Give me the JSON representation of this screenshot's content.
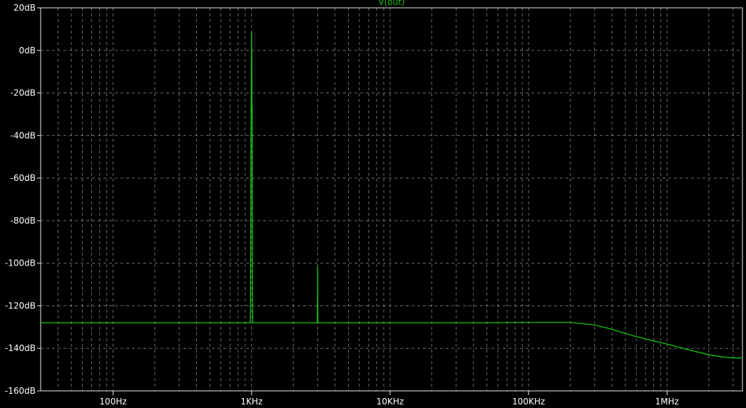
{
  "chart_data": {
    "type": "line",
    "title": "",
    "legend": "V(out)",
    "xscale": "log",
    "xlim": [
      30,
      3500000
    ],
    "ylim": [
      -160,
      20
    ],
    "x_ticks": [
      {
        "value": 100,
        "label": "100Hz"
      },
      {
        "value": 1000,
        "label": "1KHz"
      },
      {
        "value": 10000,
        "label": "10KHz"
      },
      {
        "value": 100000,
        "label": "100KHz"
      },
      {
        "value": 1000000,
        "label": "1MHz"
      }
    ],
    "y_ticks": [
      {
        "value": 20,
        "label": "20dB"
      },
      {
        "value": 0,
        "label": "0dB"
      },
      {
        "value": -20,
        "label": "-20dB"
      },
      {
        "value": -40,
        "label": "-40dB"
      },
      {
        "value": -60,
        "label": "-60dB"
      },
      {
        "value": -80,
        "label": "-80dB"
      },
      {
        "value": -100,
        "label": "-100dB"
      },
      {
        "value": -120,
        "label": "-120dB"
      },
      {
        "value": -140,
        "label": "-140dB"
      },
      {
        "value": -160,
        "label": "-160dB"
      }
    ],
    "series": [
      {
        "name": "V(out)",
        "color": "#16c50f",
        "points": [
          [
            30,
            -128
          ],
          [
            100,
            -128
          ],
          [
            980,
            -128
          ],
          [
            985,
            -94
          ],
          [
            990,
            -40
          ],
          [
            996,
            -10
          ],
          [
            1000,
            9
          ],
          [
            1003,
            -5
          ],
          [
            1006,
            -28
          ],
          [
            1010,
            -26
          ],
          [
            1013,
            -70
          ],
          [
            1016,
            -120
          ],
          [
            1020,
            -128
          ],
          [
            2980,
            -128
          ],
          [
            2995,
            -114
          ],
          [
            3000,
            -101
          ],
          [
            3005,
            -126
          ],
          [
            3020,
            -128
          ],
          [
            10000,
            -128
          ],
          [
            50000,
            -128
          ],
          [
            100000,
            -127.8
          ],
          [
            200000,
            -127.8
          ],
          [
            300000,
            -129
          ],
          [
            400000,
            -131
          ],
          [
            500000,
            -133
          ],
          [
            600000,
            -134.5
          ],
          [
            800000,
            -136.5
          ],
          [
            1000000,
            -138
          ],
          [
            1500000,
            -141
          ],
          [
            2000000,
            -143
          ],
          [
            2500000,
            -144
          ],
          [
            3000000,
            -144.5
          ],
          [
            3500000,
            -144.5
          ]
        ]
      }
    ],
    "grid": true
  }
}
